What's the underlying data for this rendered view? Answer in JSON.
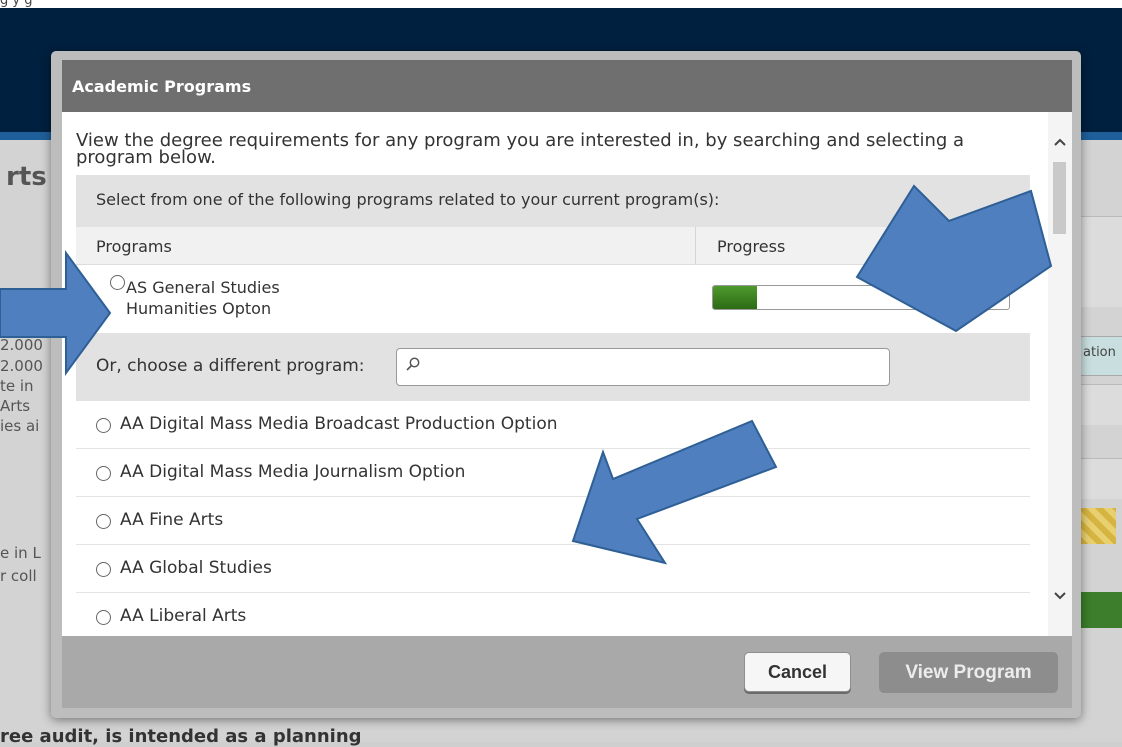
{
  "background": {
    "top_text": "g     y g",
    "heading_fragment": "rts",
    "side_lines": [
      "2.000",
      "2.000",
      "te in",
      "Arts",
      "ies ai"
    ],
    "lower_lines": [
      "e in L",
      "r coll"
    ],
    "right_pill": "ation",
    "bottom_text": "ree audit, is intended as a planning"
  },
  "modal": {
    "title": "Academic Programs",
    "intro": "View the degree requirements for any program you are interested in, by searching and selecting a program below.",
    "related_label": "Select from one of the following programs related to your current program(s):",
    "columns": {
      "programs": "Programs",
      "progress": "Progress"
    },
    "current_program": {
      "name_line1": "AS General Studies",
      "name_line2": "Humanities Opton",
      "progress_fraction": 0.15
    },
    "search": {
      "label": "Or, choose a different program:",
      "placeholder": ""
    },
    "programs": [
      "AA Digital Mass Media Broadcast Production Option",
      "AA Digital Mass Media Journalism Option",
      "AA Fine Arts",
      "AA Global Studies",
      "AA Liberal Arts"
    ],
    "buttons": {
      "cancel": "Cancel",
      "view": "View Program"
    }
  },
  "icons": {
    "search": "search-icon",
    "scroll_up": "chevron-up-icon",
    "scroll_down": "chevron-down-icon"
  },
  "colors": {
    "modal_header": "#6f6f6f",
    "progress_fill": "#2c6b14",
    "annotation_arrow": "#4f7fbf"
  }
}
